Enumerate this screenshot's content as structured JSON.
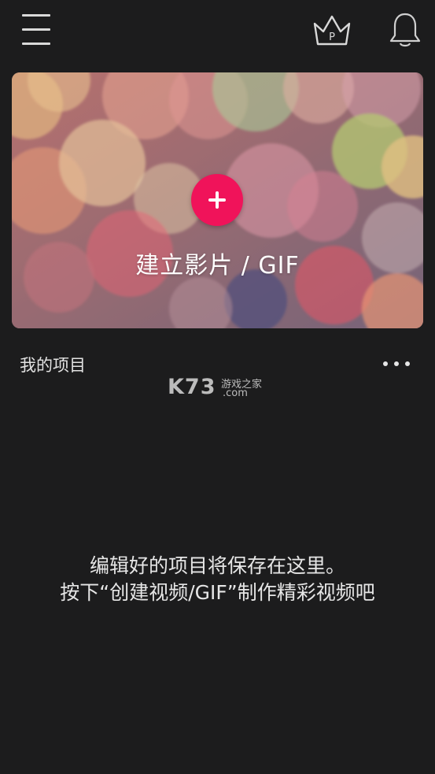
{
  "header": {
    "menu_icon": "hamburger-menu-icon",
    "premium_icon": "crown-icon",
    "premium_badge": "P",
    "notification_icon": "bell-icon"
  },
  "create_card": {
    "label": "建立影片 / GIF",
    "button_icon": "plus-icon",
    "button_color": "#f0135a"
  },
  "projects": {
    "title": "我的项目",
    "more_icon": "more-dots-icon",
    "empty_line1": "编辑好的项目将保存在这里。",
    "empty_line2": "按下“创建视频/GIF”制作精彩视频吧"
  },
  "watermark": {
    "logo": "K73",
    "cn": "游戏之家",
    "domain": ".com"
  },
  "colors": {
    "background": "#1c1c1d",
    "accent": "#f0135a",
    "text": "#e6e6e6"
  }
}
